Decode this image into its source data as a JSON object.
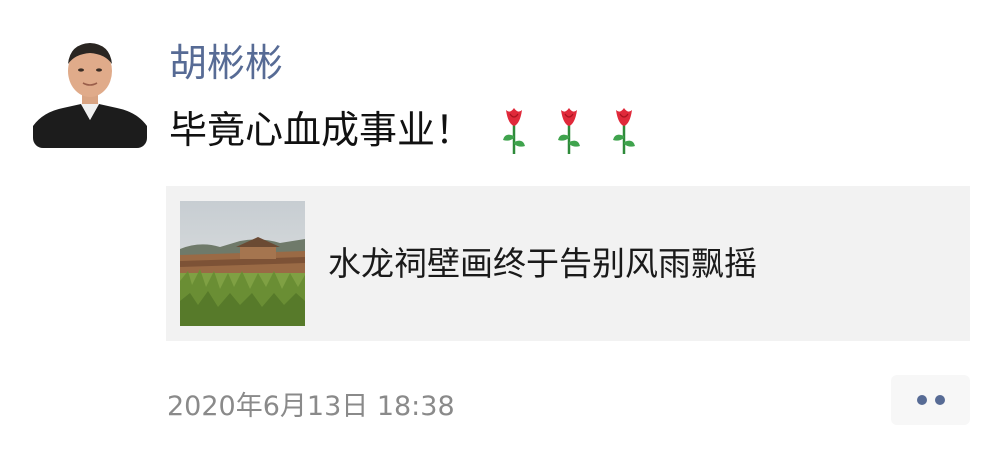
{
  "post": {
    "author_name": "胡彬彬",
    "text": "毕竟心血成事业！",
    "emoji": [
      "rose-emoji",
      "rose-emoji",
      "rose-emoji"
    ],
    "share_card": {
      "title": "水龙祠壁画终于告别风雨飘摇",
      "thumbnail": "village-wall-photo"
    },
    "timestamp": "2020年6月13日 18:38",
    "more_icon": "more-dots-icon"
  },
  "colors": {
    "author_name": "#576b95",
    "text": "#111111",
    "card_background": "#f2f2f2",
    "timestamp": "#8a8a8a",
    "more_dots": "#576b95"
  }
}
